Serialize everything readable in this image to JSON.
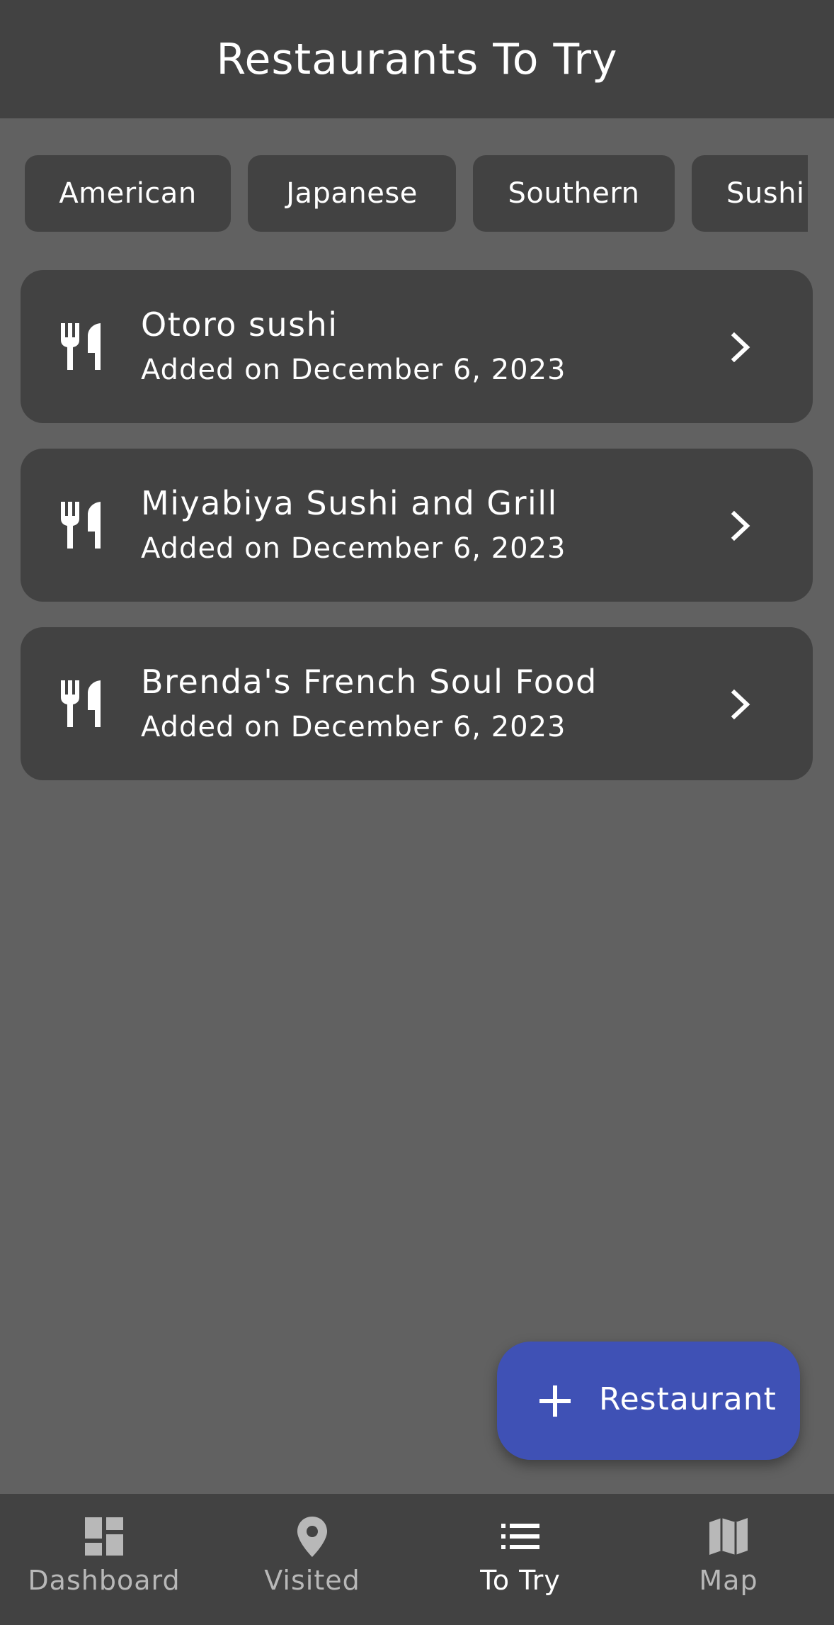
{
  "app_bar": {
    "title": "Restaurants To Try"
  },
  "filter_chips": [
    {
      "label": "American"
    },
    {
      "label": "Japanese"
    },
    {
      "label": "Southern"
    },
    {
      "label": "Sushi"
    }
  ],
  "restaurants": [
    {
      "name": "Otoro sushi",
      "added": "Added on December 6, 2023",
      "icon": "restaurant-icon",
      "trailing_icon": "chevron-right-icon"
    },
    {
      "name": "Miyabiya Sushi and Grill",
      "added": "Added on December 6, 2023",
      "icon": "restaurant-icon",
      "trailing_icon": "chevron-right-icon"
    },
    {
      "name": "Brenda's French Soul Food",
      "added": "Added on December 6, 2023",
      "icon": "restaurant-icon",
      "trailing_icon": "chevron-right-icon"
    }
  ],
  "fab": {
    "label": "Restaurant",
    "icon": "plus-icon",
    "color": "#3f51b5"
  },
  "bottom_nav": {
    "items": [
      {
        "label": "Dashboard",
        "icon": "dashboard-icon",
        "active": false
      },
      {
        "label": "Visited",
        "icon": "location-pin-icon",
        "active": false
      },
      {
        "label": "To Try",
        "icon": "list-icon",
        "active": true
      },
      {
        "label": "Map",
        "icon": "map-icon",
        "active": false
      }
    ]
  },
  "colors": {
    "background": "#616161",
    "surface": "#424242",
    "text": "#ffffff",
    "inactive_nav": "#b8b8b8",
    "accent": "#3f51b5"
  }
}
